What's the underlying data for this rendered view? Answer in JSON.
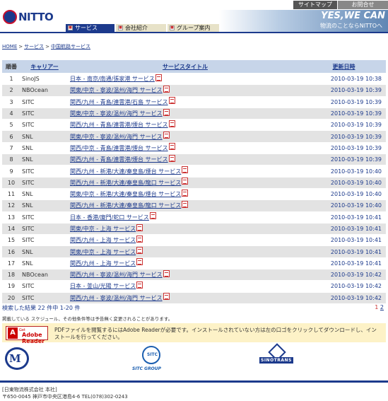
{
  "brand": {
    "logo_text": "NITTO"
  },
  "utility": {
    "sitemap": "サイトマップ",
    "contact": "お問合せ"
  },
  "tagline": {
    "line1": "YES,WE CAN",
    "line2": "物流のことならNITTOへ"
  },
  "nav": [
    {
      "label": "サービス",
      "active": true
    },
    {
      "label": "会社紹介",
      "active": false
    },
    {
      "label": "グループ案内",
      "active": false
    }
  ],
  "breadcrumb": {
    "home": "HOME",
    "services": "サービス",
    "current": "中国航路サービス",
    "separator": ">"
  },
  "table": {
    "headers": {
      "no": "順番",
      "carrier": "キャリアー",
      "title": "サービスタイトル",
      "updated": "更新日時"
    },
    "rows": [
      {
        "no": "1",
        "carrier": "SinoJS",
        "title": "日本 - 南京/南通/張家港 サービス",
        "updated": "2010-03-19 10:38"
      },
      {
        "no": "2",
        "carrier": "NBOcean",
        "title": "関東/中京 - 寧波/温州/海門 サービス",
        "updated": "2010-03-19 10:39"
      },
      {
        "no": "3",
        "carrier": "SITC",
        "title": "関西/九州 - 青島/連雲港/石島 サービス",
        "updated": "2010-03-19 10:39"
      },
      {
        "no": "4",
        "carrier": "SITC",
        "title": "関東/中京 - 寧波/温州/海門 サービス",
        "updated": "2010-03-19 10:39"
      },
      {
        "no": "5",
        "carrier": "SITC",
        "title": "関西/九州 - 青島/連雲港/煙台 サービス",
        "updated": "2010-03-19 10:39"
      },
      {
        "no": "6",
        "carrier": "SNL",
        "title": "関東/中京 - 寧波/温州/海門 サービス",
        "updated": "2010-03-19 10:39"
      },
      {
        "no": "7",
        "carrier": "SNL",
        "title": "関西/中京 - 青島/連雲港/煙台 サービス",
        "updated": "2010-03-19 10:39"
      },
      {
        "no": "8",
        "carrier": "SNL",
        "title": "関西/九州 - 青島/連雲港/煙台 サービス",
        "updated": "2010-03-19 10:39"
      },
      {
        "no": "9",
        "carrier": "SITC",
        "title": "関西/九州 - 新港/大連/秦皇島/煙台 サービス",
        "updated": "2010-03-19 10:40"
      },
      {
        "no": "10",
        "carrier": "SITC",
        "title": "関西/九州 - 新港/大連/秦皇島/龍口 サービス",
        "updated": "2010-03-19 10:40"
      },
      {
        "no": "11",
        "carrier": "SNL",
        "title": "関東/中京 - 新港/大連/秦皇島/煙台 サービス",
        "updated": "2010-03-19 10:40"
      },
      {
        "no": "12",
        "carrier": "SNL",
        "title": "関西/九州 - 新港/大連/秦皇島/龍口 サービス",
        "updated": "2010-03-19 10:40"
      },
      {
        "no": "13",
        "carrier": "SITC",
        "title": "日本 - 香港/廈門/蛇口 サービス",
        "updated": "2010-03-19 10:41"
      },
      {
        "no": "14",
        "carrier": "SITC",
        "title": "関東/中京 - 上海 サービス",
        "updated": "2010-03-19 10:41"
      },
      {
        "no": "15",
        "carrier": "SITC",
        "title": "関西/九州 - 上海 サービス",
        "updated": "2010-03-19 10:41"
      },
      {
        "no": "16",
        "carrier": "SNL",
        "title": "関東/中京 - 上海 サービス",
        "updated": "2010-03-19 10:41"
      },
      {
        "no": "17",
        "carrier": "SNL",
        "title": "関西/九州 - 上海 サービス",
        "updated": "2010-03-19 10:41"
      },
      {
        "no": "18",
        "carrier": "NBOcean",
        "title": "関西/九州 - 寧波/温州/海門 サービス",
        "updated": "2010-03-19 10:42"
      },
      {
        "no": "19",
        "carrier": "SITC",
        "title": "日本 - 釜山/光陽 サービス",
        "updated": "2010-03-19 10:42"
      },
      {
        "no": "20",
        "carrier": "SITC",
        "title": "関西/九州 - 寧波/温州/海門 サービス",
        "updated": "2010-03-19 10:42"
      }
    ]
  },
  "result": {
    "summary": "検索した結果 22 件中 1-20 件",
    "page_current": "1",
    "page_next": "2"
  },
  "note": "掲載している スケジュール、その他条件等は予告無く変更されることがあります。",
  "adobe": {
    "get": "Get",
    "product": "Adobe Reader",
    "text": "PDFファイルを閲覧するにはAdobe Readerが必要です。インストールされていない方は左の口ゴをクリックしてダウンロードし、インストールを行ってください。"
  },
  "partners": {
    "sitc_label": "SITC GROUP",
    "sinotrans_label": "SINOTRANS",
    "sitc_globe": "SITC"
  },
  "footer": {
    "company": "[日東物流株式会社 本社]",
    "address": "〒650-0045 神戸市中央区港島4-6 TEL(078)302-0243"
  }
}
